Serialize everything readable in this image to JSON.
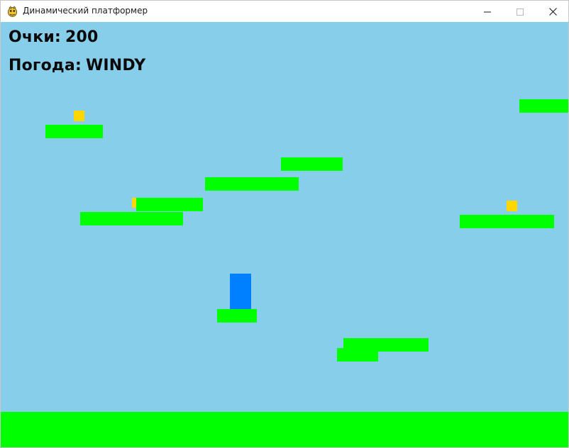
{
  "window": {
    "title": "Динамический платформер",
    "icon": "pygame-snake-icon",
    "controls": {
      "minimize_icon": "minimize-icon",
      "maximize_icon": "maximize-icon",
      "close_icon": "close-icon"
    }
  },
  "hud": {
    "score_label": "Очки:",
    "score_value": "200",
    "weather_label": "Погода:",
    "weather_value": "WINDY"
  },
  "colors": {
    "sky": "#87ceeb",
    "platform": "#00ff00",
    "coin": "#ffd700",
    "player": "#0080ff"
  }
}
